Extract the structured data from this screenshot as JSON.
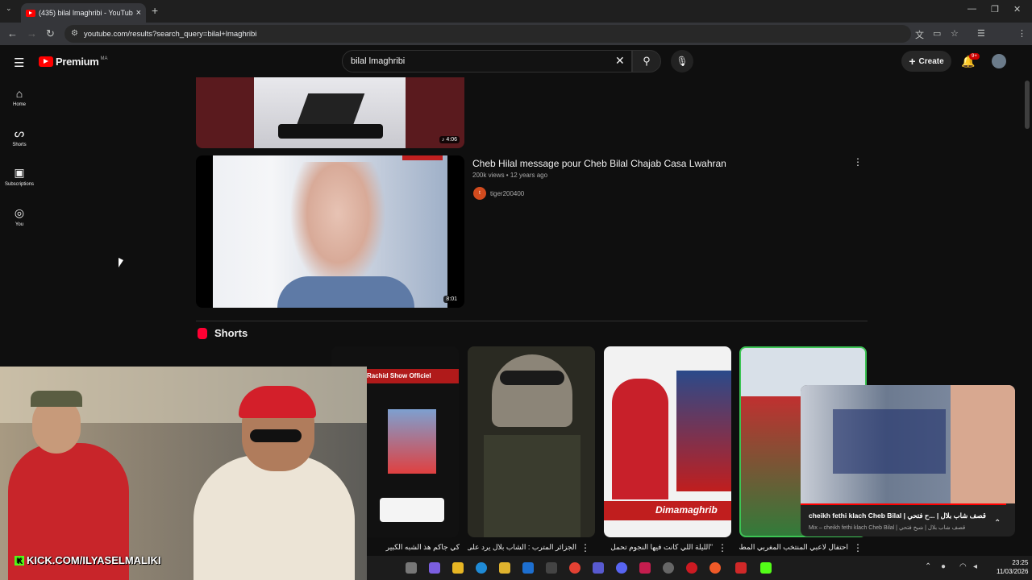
{
  "browser": {
    "tab_title": "(435) bilal lmaghribi - YouTube",
    "url": "youtube.com/results?search_query=bilal+lmaghribi"
  },
  "header": {
    "brand": "Premium",
    "region": "MA",
    "search_value": "bilal lmaghribi",
    "create_label": "Create",
    "notification_count": "9+"
  },
  "sidebar": {
    "items": [
      {
        "label": "Home",
        "icon": "home-icon"
      },
      {
        "label": "Shorts",
        "icon": "shorts-icon"
      },
      {
        "label": "Subscriptions",
        "icon": "subscriptions-icon"
      },
      {
        "label": "You",
        "icon": "you-icon"
      }
    ]
  },
  "results": {
    "video1_duration": "4:06",
    "video2": {
      "title": "Cheb Hilal message pour Cheb Bilal Chajab Casa Lwahran",
      "meta": "200k views • 12 years ago",
      "channel": "tiger200400",
      "duration": "8:01"
    }
  },
  "shorts": {
    "heading": "Shorts",
    "items": [
      {
        "caption": "كي جاكم هذ الشبه الكبير"
      },
      {
        "caption": "الجزائر المترب : الشاب بلال يرد على"
      },
      {
        "caption": "\"الليلة اللي كانت فيها النجوم تحمل"
      },
      {
        "caption": "احتفال لاعبي المنتخب المغربي المطي"
      }
    ],
    "overlay_text_1": "Rachid Show Officiel",
    "overlay_text_2": "Dimamaghrib"
  },
  "webcam": {
    "kick_handle": "KICK.COM/ILYASELMALIKI"
  },
  "miniplayer": {
    "title": "cheikh fethi klach Cheb Bilal | قصف شاب بلال | ...ح فتحي",
    "subtitle": "Mix – cheikh fethi klach Cheb Bilal | قصف شاب بلال | شيخ فتحي"
  },
  "taskbar": {
    "time": "23:25",
    "date": "11/03/2026"
  }
}
